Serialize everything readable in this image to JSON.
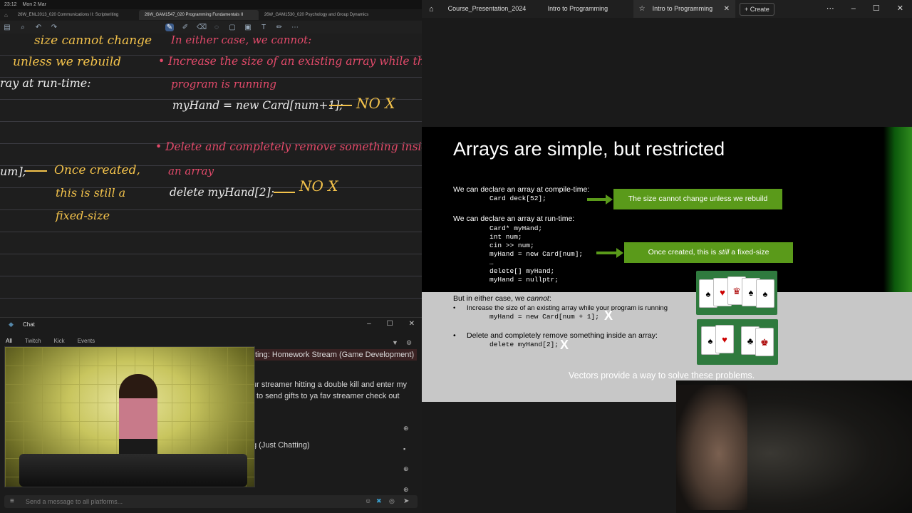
{
  "notes_app": {
    "status_time": "23:12",
    "status_date": "Mon 2 Mar",
    "tabs": [
      {
        "label": "26W_ENL2013_020 Communications II: Scriptwriting",
        "active": false
      },
      {
        "label": "26W_GAM1547_020 Programming Fundamentals II",
        "active": true
      },
      {
        "label": "26W_GAM1530_020 Psychology and Group Dynamics",
        "active": false
      }
    ],
    "notes": {
      "left_1": "size cannot change",
      "left_2": "unless we rebuild",
      "left_3": "ray at run-time:",
      "left_4": "um];",
      "left_5": "Once created,",
      "left_6": "this is still a",
      "left_7": "fixed-size",
      "right_1": "In either case, we cannot:",
      "right_2": "• Increase the size of an existing array while the",
      "right_3": "program is running",
      "right_4": "myHand = new Card[num+1];",
      "right_5": "NO   X",
      "right_6": "• Delete and completely remove something inside",
      "right_7": "an array",
      "right_8": "delete myHand[2];",
      "right_9": "NO   X"
    }
  },
  "chat": {
    "title": "Chat",
    "tabs": [
      "All",
      "Twitch",
      "Kick",
      "Events"
    ],
    "messages": [
      "ting: Homework Stream (Game Development)",
      "ur streamer hitting a double kill and enter my",
      "to send gifts to ya fav streamer check out",
      "g (Just Chatting)"
    ],
    "input_placeholder": "Send a message to all platforms..."
  },
  "browser": {
    "tabs": [
      {
        "label": "Course_Presentation_2024",
        "active": false
      },
      {
        "label": "Intro to Programming",
        "active": false
      },
      {
        "label": "Intro to Programming",
        "active": true
      }
    ],
    "create_label": "+ Create"
  },
  "slide": {
    "title": "Arrays are simple, but restricted",
    "compile_label": "We can declare an array at compile-time:",
    "compile_code": "Card deck[52];",
    "runtime_label": "We can declare an array at run-time:",
    "runtime_code": [
      "Card* myHand;",
      "int num;",
      "cin >> num;",
      "myHand = new Card[num];",
      "…",
      "delete[] myHand;",
      "myHand = nullptr;"
    ],
    "callout_1": "The size cannot change unless we rebuild",
    "callout_2_pre": "Once created, this is ",
    "callout_2_em": "still",
    "callout_2_post": " a fixed-size",
    "cannot_label": "But in either case, we ",
    "cannot_em": "cannot",
    "cannot_colon": ":",
    "bullet_1": "Increase the size of an existing array while your program is running",
    "bullet_1_code": "myHand = new Card[num + 1];",
    "bullet_2": "Delete and completely remove something inside an array:",
    "bullet_2_code": "delete myHand[2];",
    "x_mark": "X",
    "footer": "Vectors provide a way to solve these problems."
  },
  "colors": {
    "handwriting_yellow": "#f3c24b",
    "handwriting_pink": "#e24a6a",
    "slide_green": "#5a9a1a"
  }
}
